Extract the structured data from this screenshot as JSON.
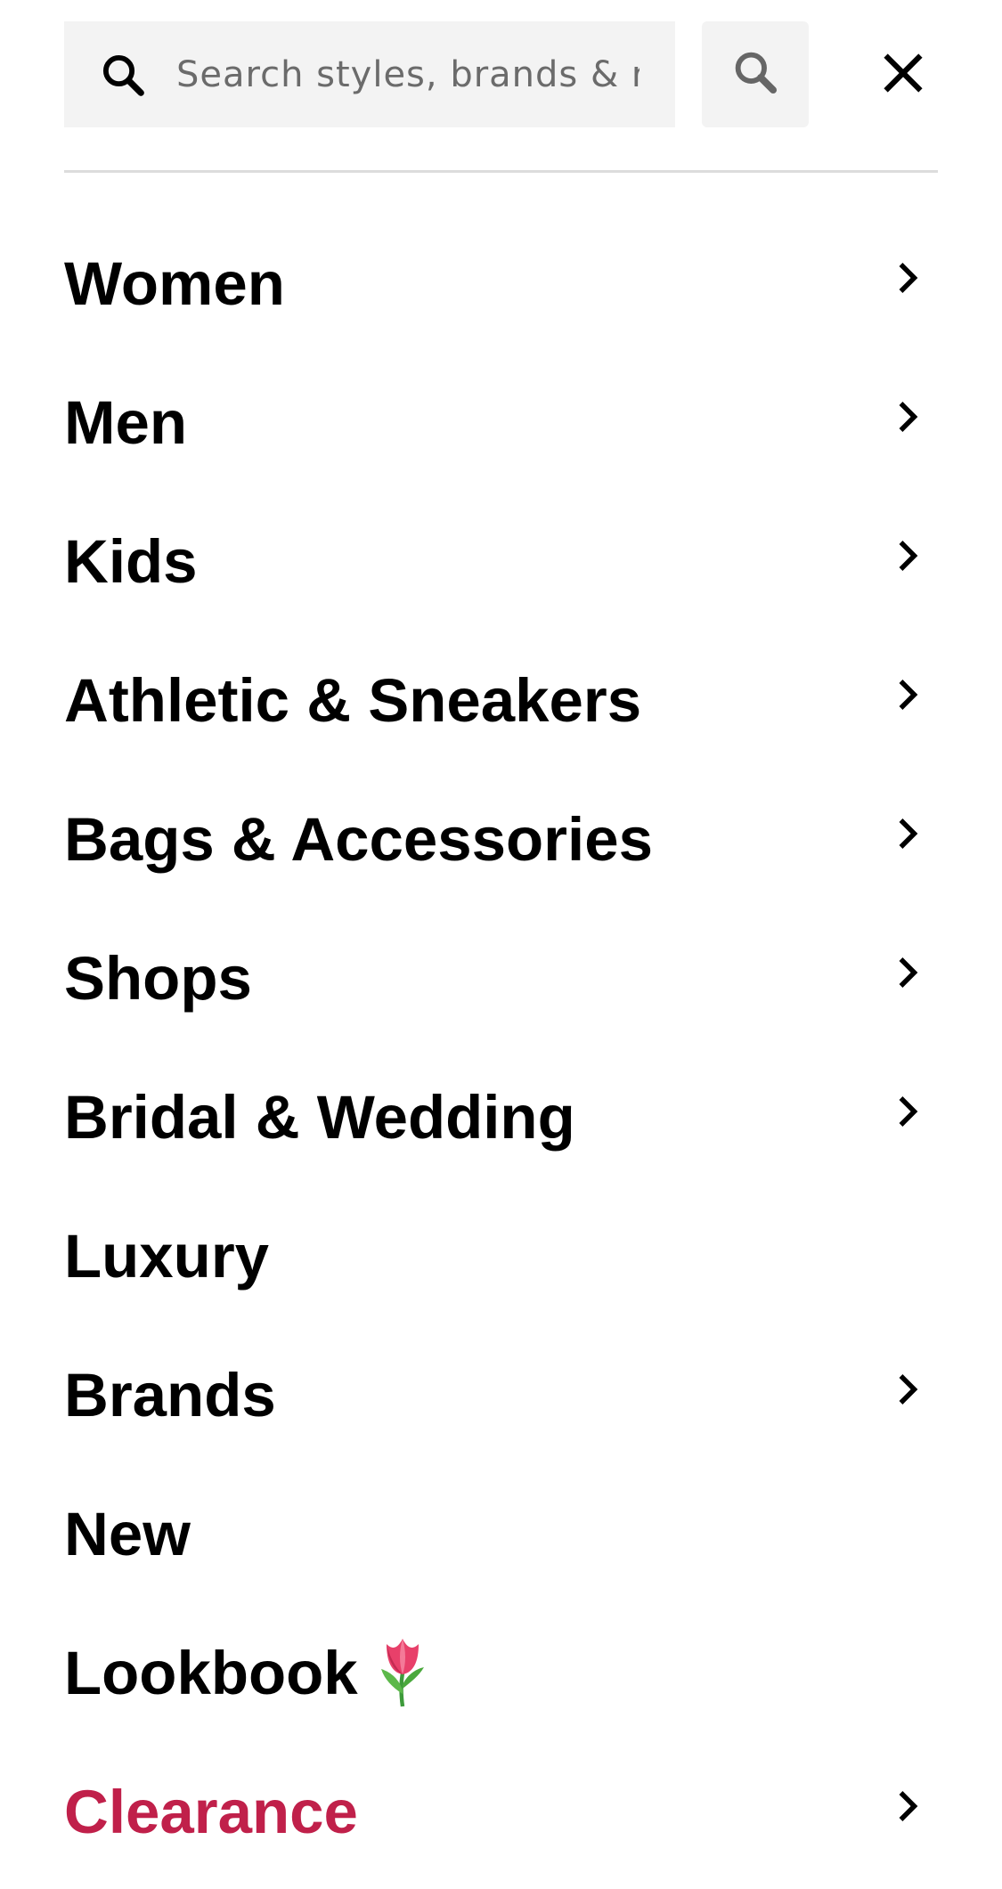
{
  "search": {
    "placeholder": "Search styles, brands & r"
  },
  "icons": {
    "search_leading": "search-icon",
    "search_button": "search-icon",
    "close": "close-icon",
    "chevron": "chevron-right-icon",
    "tulip": "tulip-emoji-icon"
  },
  "colors": {
    "text": "#000000",
    "clearance": "#c0204a",
    "search_bg": "#f3f3f3",
    "divider": "#dcdcdc"
  },
  "menu": {
    "items": [
      {
        "label": "Women",
        "has_chevron": true
      },
      {
        "label": "Men",
        "has_chevron": true
      },
      {
        "label": "Kids",
        "has_chevron": true
      },
      {
        "label": "Athletic & Sneakers",
        "has_chevron": true
      },
      {
        "label": "Bags & Accessories",
        "has_chevron": true
      },
      {
        "label": "Shops",
        "has_chevron": true
      },
      {
        "label": "Bridal & Wedding",
        "has_chevron": true
      },
      {
        "label": "Luxury",
        "has_chevron": false
      },
      {
        "label": "Brands",
        "has_chevron": true
      },
      {
        "label": "New",
        "has_chevron": false
      },
      {
        "label": "Lookbook",
        "has_chevron": false
      },
      {
        "label": "Clearance",
        "has_chevron": true
      }
    ]
  }
}
